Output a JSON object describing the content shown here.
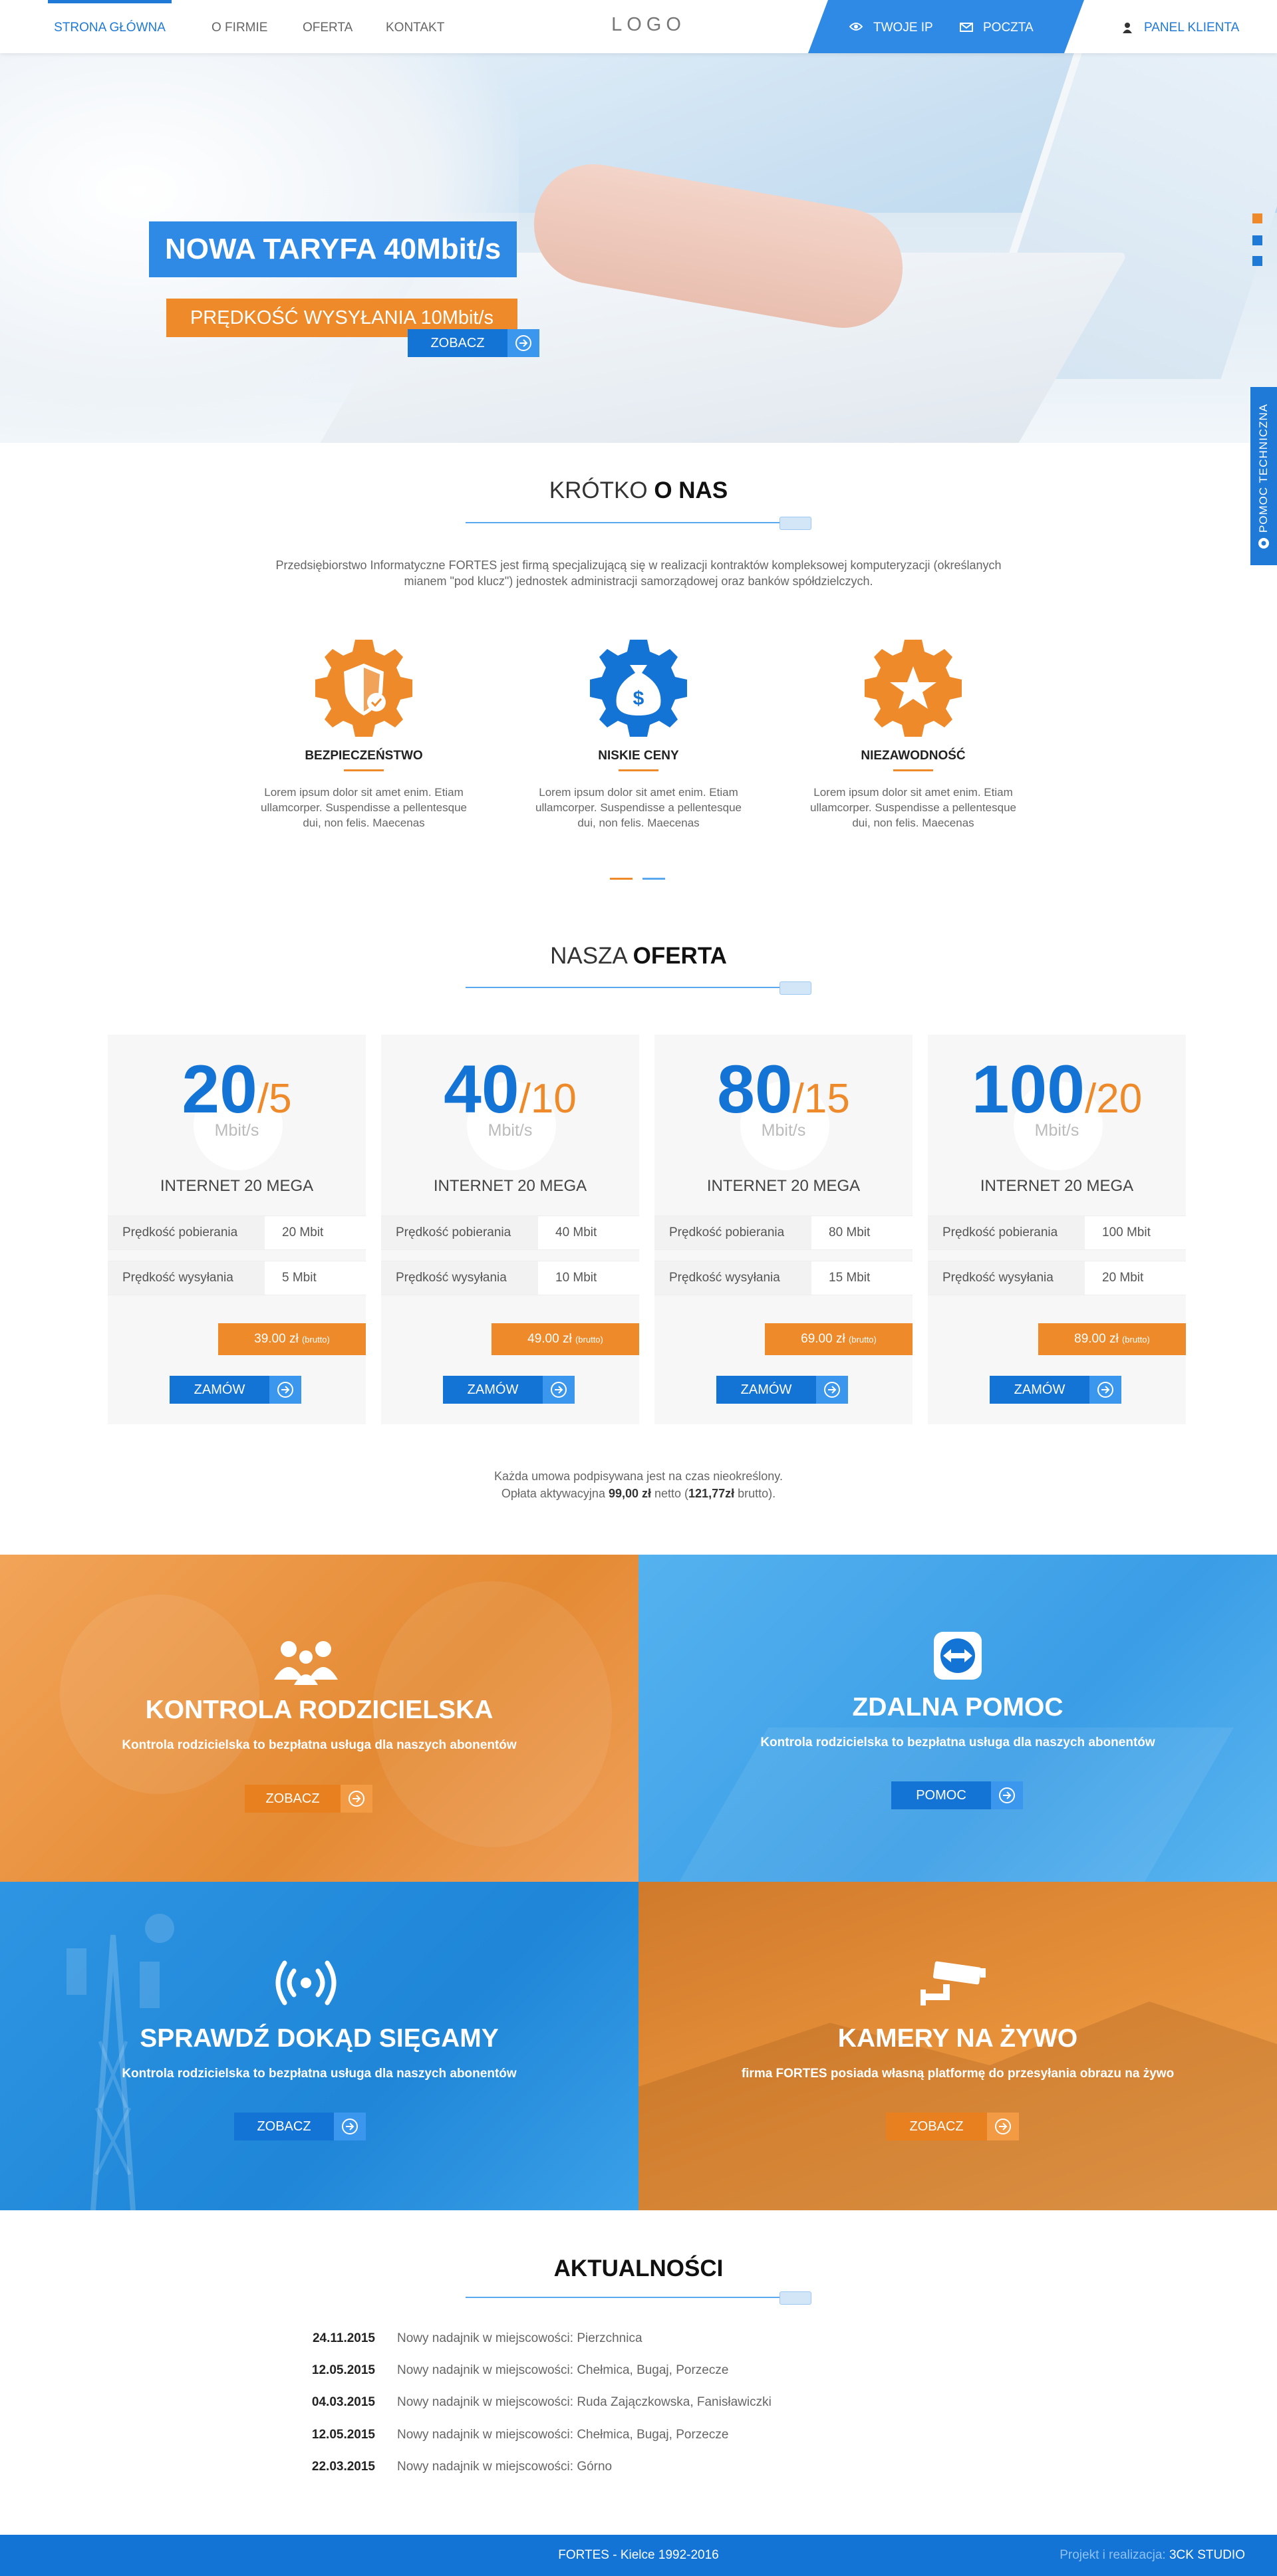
{
  "nav": {
    "items": [
      "STRONA GŁÓWNA",
      "O FIRMIE",
      "OFERTA",
      "KONTAKT"
    ],
    "logo": "LOGO",
    "ip": "TWOJE IP",
    "mail": "POCZTA",
    "panel": "PANEL KLIENTA"
  },
  "hero": {
    "title": "NOWA TARYFA 40Mbit/s",
    "subtitle": "PRĘDKOŚĆ WYSYŁANIA 10Mbit/s",
    "button": "ZOBACZ",
    "slides_indicator_colors": [
      "#ee8a2a",
      "#1f79d6",
      "#1f79d6"
    ]
  },
  "support_tab": "POMOC TECHNICZNA",
  "about": {
    "title_light": "KRÓTKO ",
    "title_bold": "O NAS",
    "text": "Przedsiębiorstwo Informatyczne FORTES jest firmą specjalizującą się w realizacji kontraktów kompleksowej komputeryzacji (określanych mianem \"pod klucz\") jednostek administracji samorządowej oraz banków spółdzielczych.",
    "features": [
      {
        "icon": "shield-check-icon",
        "color": "#ee8a2a",
        "title": "BEZPIECZEŃSTWO",
        "text": "Lorem ipsum dolor sit amet enim. Etiam ullamcorper. Suspendisse a pellentesque dui, non felis. Maecenas"
      },
      {
        "icon": "money-bag-icon",
        "color": "#1474d6",
        "title": "NISKIE CENY",
        "text": "Lorem ipsum dolor sit amet enim. Etiam ullamcorper. Suspendisse a pellentesque dui, non felis. Maecenas"
      },
      {
        "icon": "star-icon",
        "color": "#ee8a2a",
        "title": "NIEZAWODNOŚĆ",
        "text": "Lorem ipsum dolor sit amet enim. Etiam ullamcorper. Suspendisse a pellentesque dui, non felis. Maecenas"
      }
    ]
  },
  "offer": {
    "title_light": "NASZA ",
    "title_bold": "OFERTA",
    "unit": "Mbit/s",
    "down_label": "Prędkość pobierania",
    "up_label": "Prędkość wysyłania",
    "order": "ZAMÓW",
    "currency": "zł",
    "brutto": "(brutto)",
    "plans": [
      {
        "down": "20",
        "up": "/5",
        "name": "INTERNET 20 MEGA",
        "down_val": "20 Mbit",
        "up_val": "5 Mbit",
        "price": "39.00"
      },
      {
        "down": "40",
        "up": "/10",
        "name": "INTERNET 20 MEGA",
        "down_val": "40 Mbit",
        "up_val": "10 Mbit",
        "price": "49.00"
      },
      {
        "down": "80",
        "up": "/15",
        "name": "INTERNET 20 MEGA",
        "down_val": "80 Mbit",
        "up_val": "15 Mbit",
        "price": "69.00"
      },
      {
        "down": "100",
        "up": "/20",
        "name": "INTERNET 20 MEGA",
        "down_val": "100 Mbit",
        "up_val": "20 Mbit",
        "price": "89.00"
      }
    ],
    "note1": "Każda umowa podpisywana jest na czas nieokreślony.",
    "note2_a": "Opłata aktywacyjna ",
    "note2_b": "99,00 zł",
    "note2_c": " netto (",
    "note2_d": "121,77zł",
    "note2_e": " brutto)."
  },
  "tiles": [
    {
      "icon": "family-icon",
      "title": "KONTROLA RODZICIELSKA",
      "text": "Kontrola rodzicielska to bezpłatna usługa dla naszych abonentów",
      "button": "ZOBACZ"
    },
    {
      "icon": "teamviewer-icon",
      "title": "ZDALNA POMOC",
      "text": "Kontrola rodzicielska to bezpłatna usługa dla naszych abonentów",
      "button": "POMOC"
    },
    {
      "icon": "signal-icon",
      "title": "SPRAWDŹ DOKĄD SIĘGAMY",
      "text": "Kontrola rodzicielska to bezpłatna usługa dla naszych abonentów",
      "button": "ZOBACZ"
    },
    {
      "icon": "camera-icon",
      "title": "KAMERY NA ŻYWO",
      "text": "firma FORTES posiada własną platformę do przesyłania obrazu na żywo",
      "button": "ZOBACZ"
    }
  ],
  "news": {
    "title": "AKTUALNOŚCI",
    "items": [
      {
        "date": "24.11.2015",
        "text": "Nowy nadajnik w miejscowości: Pierzchnica"
      },
      {
        "date": "12.05.2015",
        "text": "Nowy nadajnik w miejscowości: Chełmica, Bugaj, Porzecze"
      },
      {
        "date": "04.03.2015",
        "text": "Nowy nadajnik w miejscowości: Ruda Zajączkowska, Fanisławiczki"
      },
      {
        "date": "12.05.2015",
        "text": "Nowy nadajnik w miejscowości: Chełmica, Bugaj, Porzecze"
      },
      {
        "date": "22.03.2015",
        "text": "Nowy nadajnik w miejscowości: Górno"
      }
    ]
  },
  "footer": {
    "center": "FORTES - Kielce 1992-2016",
    "credit_label": "Projekt i realizacja: ",
    "credit_name": "3CK STUDIO"
  }
}
